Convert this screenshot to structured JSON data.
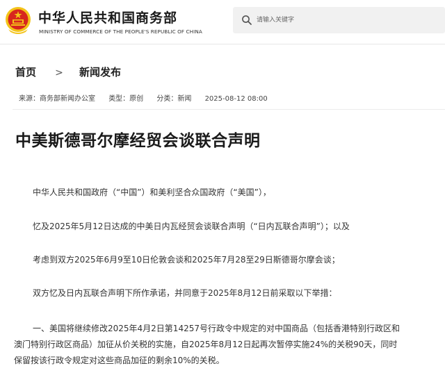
{
  "header": {
    "brand_cn": "中华人民共和国商务部",
    "brand_en": "MINISTRY OF COMMERCE OF THE PEOPLE'S REPUBLIC OF CHINA",
    "emblem_icon": "national-emblem-icon",
    "search": {
      "placeholder": "请输入关键字",
      "icon": "search-icon"
    }
  },
  "breadcrumb": {
    "home": "首页",
    "separator": ">",
    "section": "新闻发布"
  },
  "meta": {
    "source": "来源：商务部新闻办公室",
    "type": "类型：原创",
    "category": "分类：新闻",
    "datetime": "2025-08-12 08:00"
  },
  "article": {
    "title": "中美斯德哥尔摩经贸会谈联合声明",
    "paragraphs": [
      "中华人民共和国政府（“中国”）和美利坚合众国政府（“美国”），",
      "忆及2025年5月12日达成的中美日内瓦经贸会谈联合声明（“日内瓦联合声明”）；以及",
      "考虑到双方2025年6月9至10日伦敦会谈和2025年7月28至29日斯德哥尔摩会谈；",
      "双方忆及日内瓦联合声明下所作承诺，并同意于2025年8月12日前采取以下举措："
    ],
    "item1_lines": [
      "一、美国将继续修改2025年4月2日第14257号行政令中规定的对中国商品（包括香港特别行政区和",
      "澳门特别行政区商品）加征从价关税的实施，自2025年8月12日起再次暂停实施24%的关税90天，同时",
      "保留按该行政令规定对这些商品加征的剩余10%的关税。"
    ]
  },
  "colors": {
    "emblem_red": "#d7261e",
    "emblem_gold": "#f3c319",
    "search_bg": "#f1f1f1"
  }
}
